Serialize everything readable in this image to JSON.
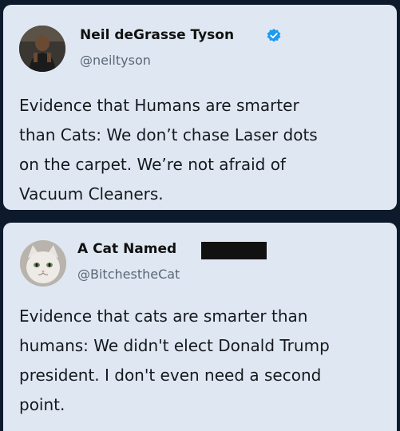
{
  "tweets": [
    {
      "author_name": "Neil deGrasse Tyson",
      "handle": "@neiltyson",
      "verified": true,
      "verified_color": "#1d9bf0",
      "text": "Evidence that Humans are smarter\nthan Cats:  We don’t chase Laser dots\non the carpet. We’re not afraid of\nVacuum Cleaners."
    },
    {
      "author_name": "A Cat Named",
      "handle": "@BitchestheCat",
      "name_redacted": true,
      "text": "Evidence that cats are smarter than\nhumans: We didn't elect Donald Trump\npresident. I don't even need a second\npoint."
    }
  ],
  "colors": {
    "card_background": "#dfe8f2",
    "separator": "#0d1a2b",
    "verified": "#1d9bf0"
  }
}
